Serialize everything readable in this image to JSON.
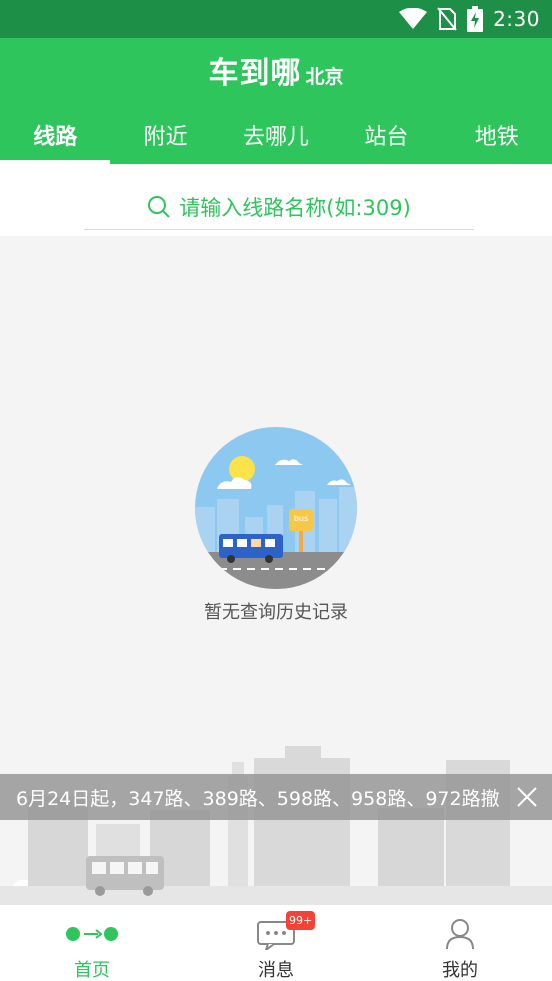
{
  "status_bar": {
    "time": "2:30"
  },
  "header": {
    "title": "车到哪",
    "city": "北京"
  },
  "tabs": [
    {
      "label": "线路",
      "active": true
    },
    {
      "label": "附近",
      "active": false
    },
    {
      "label": "去哪儿",
      "active": false
    },
    {
      "label": "站台",
      "active": false
    },
    {
      "label": "地铁",
      "active": false
    }
  ],
  "search": {
    "placeholder": "请输入线路名称(如:309)"
  },
  "empty_state": {
    "message": "暂无查询历史记录",
    "illustration_sign": "bus"
  },
  "notice": {
    "text": "6月24日起，347路、389路、598路、958路、972路撤"
  },
  "bottom_nav": {
    "items": [
      {
        "label": "首页",
        "active": true
      },
      {
        "label": "消息",
        "active": false
      },
      {
        "label": "我的",
        "active": false
      }
    ],
    "message_badge": "99+"
  },
  "colors": {
    "brand": "#2ec55c",
    "status_bar": "#1e8f46",
    "badge": "#f44336"
  }
}
